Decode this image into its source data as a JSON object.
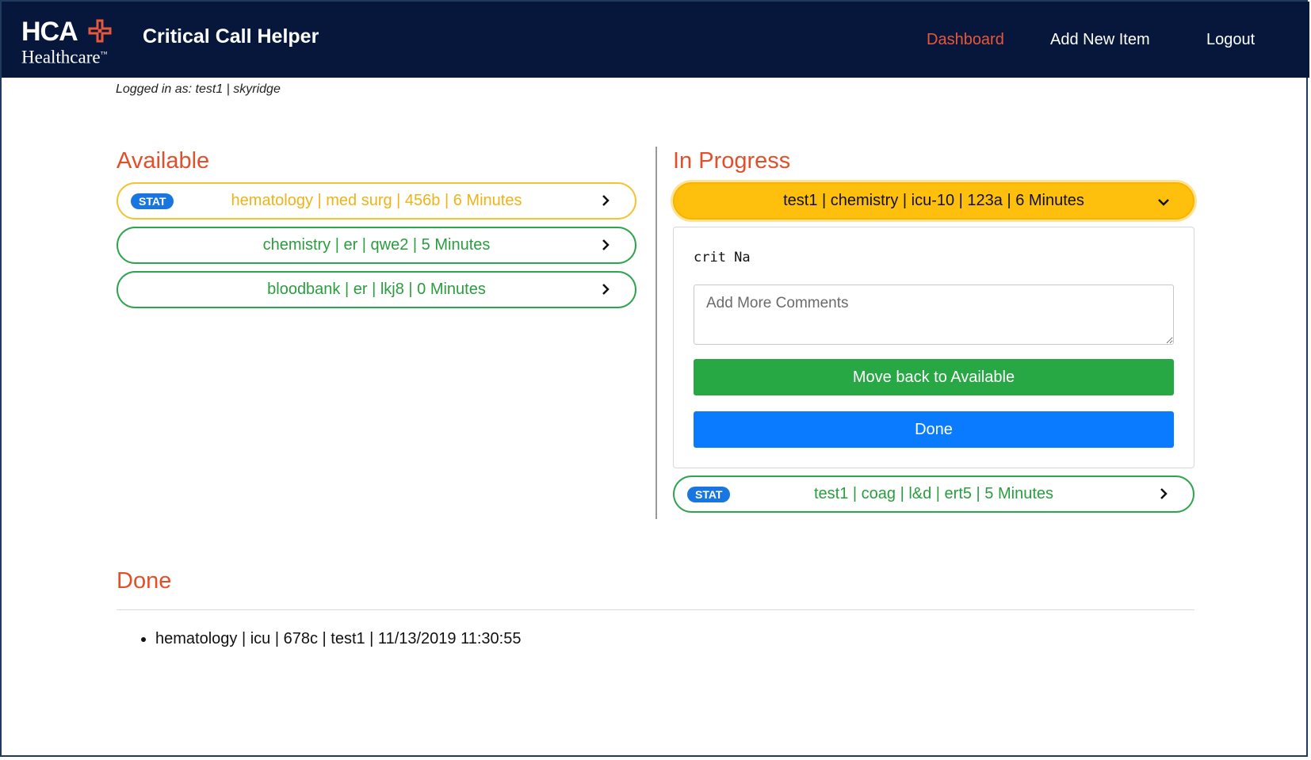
{
  "brand": {
    "logo_top": "HCA",
    "logo_bottom": "Healthcare",
    "logo_tm": "™",
    "app_title": "Critical Call Helper"
  },
  "nav": {
    "dashboard": "Dashboard",
    "add_new": "Add New Item",
    "logout": "Logout"
  },
  "session": {
    "logged_in": "Logged in as: test1 | skyridge"
  },
  "available": {
    "title": "Available",
    "items": [
      {
        "badge": "STAT",
        "text": "hematology | med surg | 456b | 6 Minutes",
        "priority": "stat",
        "color": "#efb318"
      },
      {
        "badge": "",
        "text": "chemistry | er | qwe2 | 5 Minutes",
        "priority": "normal",
        "color": "#2a9d3f"
      },
      {
        "badge": "",
        "text": "bloodbank | er | lkj8 | 0 Minutes",
        "priority": "normal",
        "color": "#2a9d3f"
      }
    ]
  },
  "in_progress": {
    "title": "In Progress",
    "active_item": {
      "text": "test1 | chemistry | icu-10 | 123a | 6 Minutes",
      "note": "crit Na",
      "comments_placeholder": "Add More Comments",
      "move_back_label": "Move back to Available",
      "done_label": "Done"
    },
    "items": [
      {
        "badge": "STAT",
        "text": "test1 | coag | l&d | ert5 | 5 Minutes"
      }
    ]
  },
  "done": {
    "title": "Done",
    "items": [
      "hematology | icu | 678c | test1 | 11/13/2019 11:30:55"
    ]
  },
  "colors": {
    "nav_bg": "#07173c",
    "accent": "#e0502a",
    "stat_badge": "#1976e0",
    "active_item": "#fec00c",
    "green_button": "#28a745",
    "blue_button": "#0a7bff"
  }
}
